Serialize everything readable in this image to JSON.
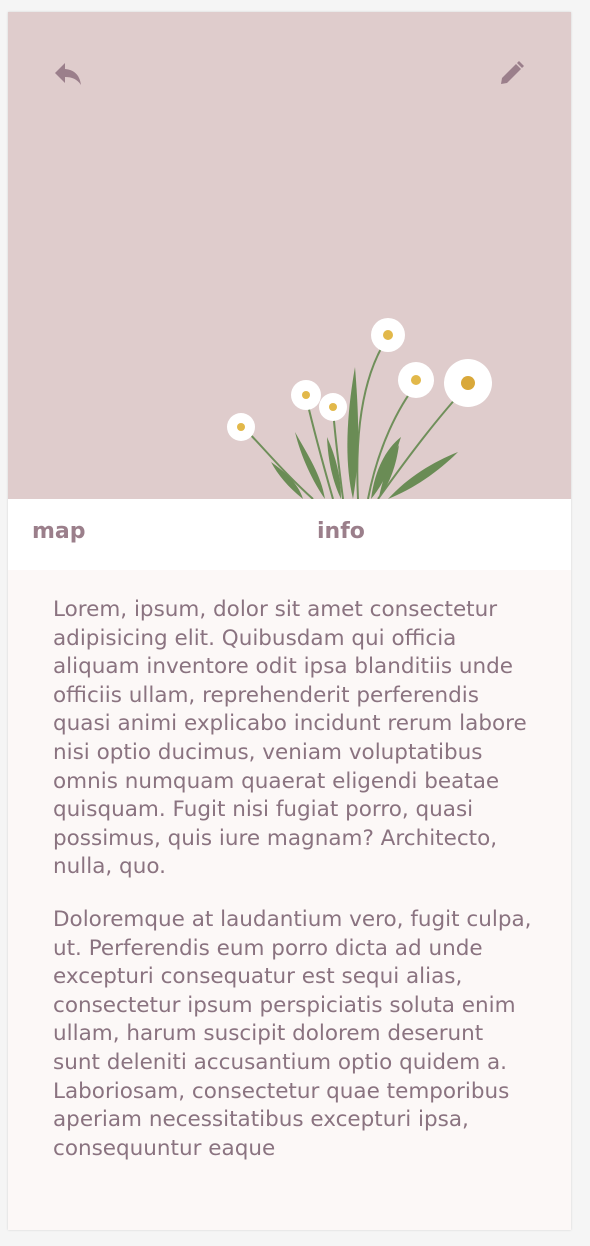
{
  "header": {
    "back_icon": "reply-arrow-icon",
    "edit_icon": "pencil-icon",
    "hero_image": "daisy-flowers-illustration"
  },
  "tabs": [
    {
      "label": "map"
    },
    {
      "label": "info"
    }
  ],
  "content": {
    "paragraphs": [
      "Lorem, ipsum, dolor sit amet consectetur adipisicing elit. Quibusdam qui officia aliquam inventore odit ipsa blanditiis unde officiis ullam, reprehenderit perferendis quasi animi explicabo incidunt rerum labore nisi optio ducimus, veniam voluptatibus omnis numquam quaerat eligendi beatae quisquam. Fugit nisi fugiat porro, quasi possimus, quis iure magnam? Architecto, nulla, quo.",
      "Doloremque at laudantium vero, fugit culpa, ut. Perferendis eum porro dicta ad unde excepturi consequatur est sequi alias, consectetur ipsum perspiciatis soluta enim ullam, harum suscipit dolorem deserunt sunt deleniti accusantium optio quidem a. Laboriosam, consectetur quae temporibus aperiam necessitatibus excepturi ipsa, consequuntur eaque"
    ]
  },
  "colors": {
    "hero_bg": "#dfcccc",
    "icon": "#9b7f8b",
    "tab_text": "#9b7f8b",
    "body_text": "#8a7380",
    "content_bg": "#fcf8f7"
  }
}
